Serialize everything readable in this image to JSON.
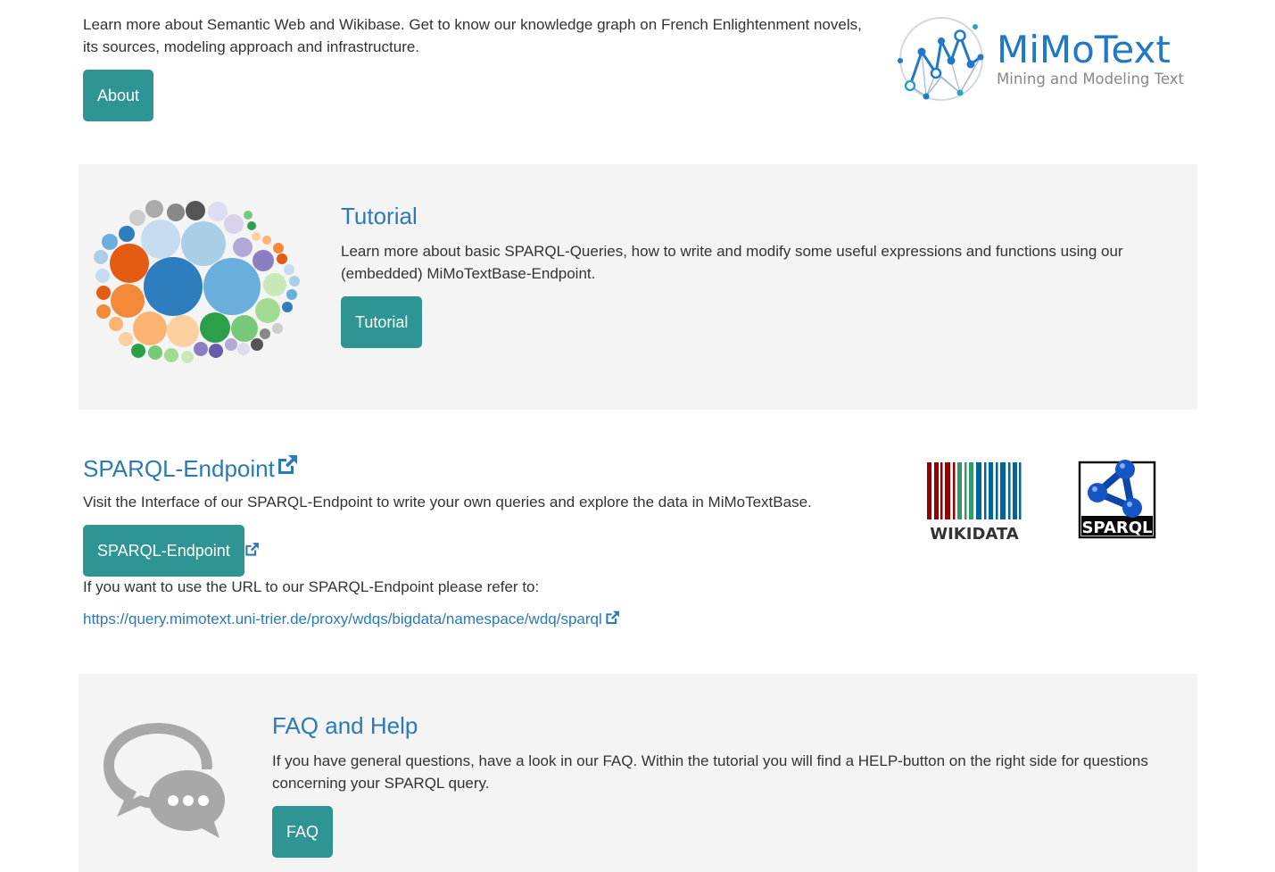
{
  "about": {
    "text": "Learn more about Semantic Web and Wikibase. Get to know our knowledge graph on French Enlightenment novels, its sources, modeling approach and infrastructure.",
    "button_label": "About"
  },
  "logo": {
    "name": "MiMoText",
    "tagline": "Mining and Modeling Text",
    "colors": {
      "primary": "#1f78c8",
      "nodes": "#1f78c8",
      "tagline": "#888888"
    }
  },
  "tutorial": {
    "title": "Tutorial",
    "text": "Learn more about basic SPARQL-Queries, how to write and modify some useful expressions and functions using our (embedded) MiMoTextBase-Endpoint.",
    "button_label": "Tutorial"
  },
  "sparql": {
    "title": "SPARQL-Endpoint",
    "text": "Visit the Interface of our SPARQL-Endpoint to write your own queries and explore the data in MiMoTextBase.",
    "button_label": "SPARQL-Endpoint",
    "url_note": "If you want to use the URL to our SPARQL-Endpoint please refer to:",
    "url": "https://query.mimotext.uni-trier.de/proxy/wdqs/bigdata/namespace/wdq/sparql",
    "logos": {
      "wikidata_label": "WIKIDATA",
      "sparql_label": "SPARQL"
    }
  },
  "faq": {
    "title": "FAQ and Help",
    "text": "If you have general questions, have a look in our FAQ. Within the tutorial you will find a HELP-button on the right side for questions concerning your SPARQL query.",
    "button_label": "FAQ"
  },
  "colors": {
    "button": "#2e9494",
    "link": "#2a7ab8",
    "panel": "#f4f4f4",
    "text": "#333333"
  },
  "icons": {
    "external_link": "external-link-icon",
    "chat": "chat-bubbles-icon"
  }
}
